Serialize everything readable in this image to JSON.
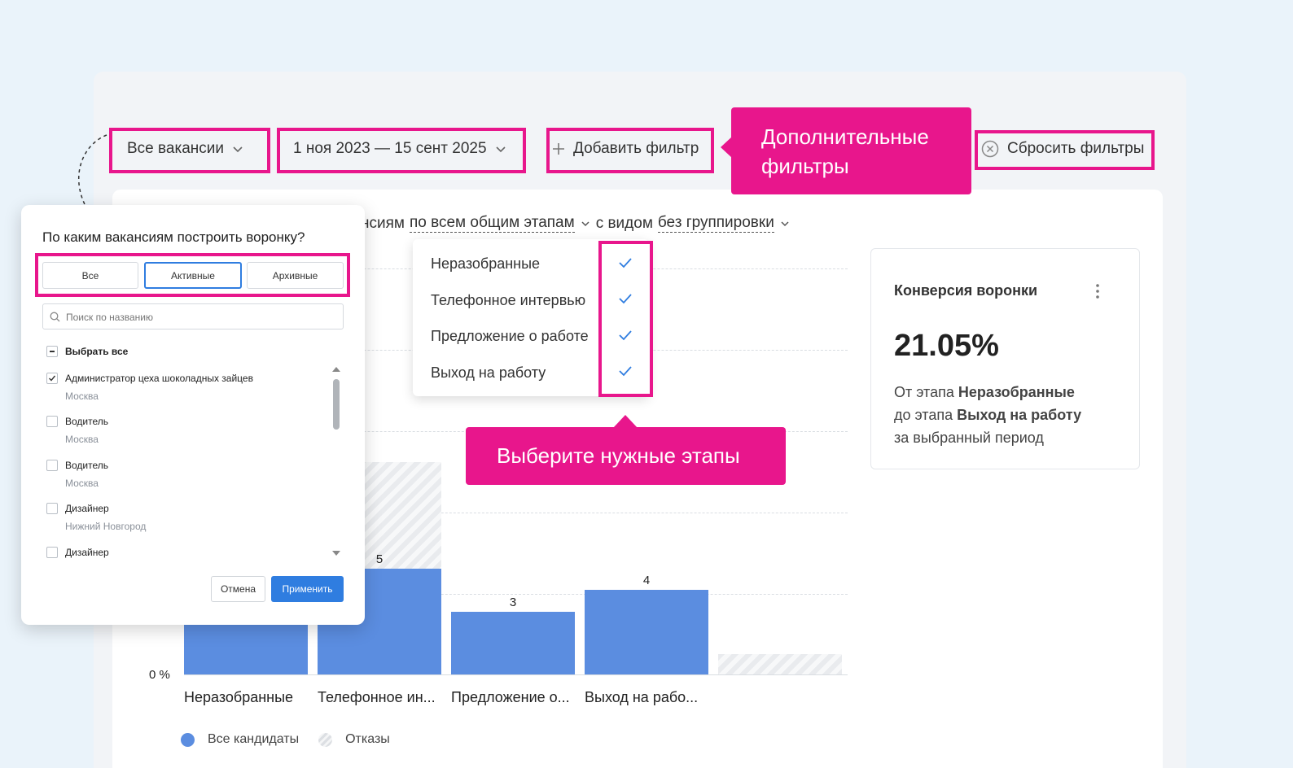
{
  "filters": {
    "vacancies": "Все вакансии",
    "period": "1 ноя 2023 — 15 сент 2025",
    "add_filter": "Добавить фильтр",
    "reset": "Сбросить фильтры"
  },
  "callouts": {
    "extra_filters_line1": "Дополнительные",
    "extra_filters_line2": "фильтры",
    "choose_stages": "Выберите нужные этапы"
  },
  "subheader": {
    "prefix": "нсиям",
    "stages_link": "по всем общим этапам",
    "middle": "с видом",
    "grouping_link": "без группировки"
  },
  "stage_dropdown": {
    "items": [
      "Неразобранные",
      "Телефонное интервью",
      "Предложение о работе",
      "Выход на работу"
    ]
  },
  "kpi": {
    "title": "Конверсия воронки",
    "value": "21.05%",
    "from_prefix": "От этапа",
    "from_stage": "Неразобранные",
    "to_prefix": "до этапа",
    "to_stage": "Выход на работу",
    "period": "за выбранный период"
  },
  "chart_data": {
    "type": "bar",
    "categories": [
      "Неразобранные",
      "Телефонное ин...",
      "Предложение о...",
      "Выход на рабо..."
    ],
    "series": [
      {
        "name": "Все кандидаты",
        "values": [
          null,
          5,
          3,
          4
        ]
      }
    ],
    "data_labels": [
      "",
      "5",
      "3",
      "4"
    ],
    "y_tick_label": "0 %",
    "legend": [
      "Все кандидаты",
      "Отказы"
    ],
    "legend_position": "bottom-left",
    "grid": true
  },
  "popup": {
    "question": "По каким вакансиям построить воронку?",
    "segments": [
      "Все",
      "Активные",
      "Архивные"
    ],
    "active_segment": "Активные",
    "search_placeholder": "Поиск по названию",
    "select_all": "Выбрать все",
    "items": [
      {
        "title": "Администратор цеха шоколадных зайцев",
        "city": "Москва",
        "checked": true
      },
      {
        "title": "Водитель",
        "city": "Москва",
        "checked": false
      },
      {
        "title": "Водитель",
        "city": "Москва",
        "checked": false
      },
      {
        "title": "Дизайнер",
        "city": "Нижний Новгород",
        "checked": false
      },
      {
        "title": "Дизайнер",
        "city": "",
        "checked": false
      }
    ],
    "cancel": "Отмена",
    "apply": "Применить"
  },
  "colors": {
    "accent_pink": "#e8168c",
    "bar_blue": "#5b8de0",
    "primary_blue": "#2f7de0"
  }
}
